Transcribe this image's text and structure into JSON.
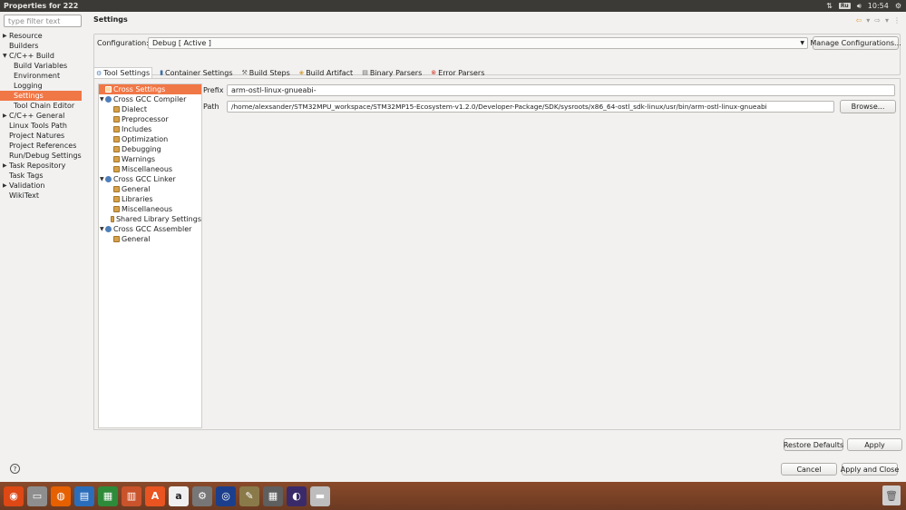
{
  "window": {
    "title": "Properties for 222",
    "keyboard_layout": "Ru",
    "clock": "10:54"
  },
  "left_panel": {
    "filter_placeholder": "type filter text",
    "items": [
      {
        "label": "Resource",
        "expandable": true,
        "indent": 1
      },
      {
        "label": "Builders",
        "expandable": false,
        "indent": 1
      },
      {
        "label": "C/C++ Build",
        "expandable": true,
        "expanded": true,
        "indent": 1
      },
      {
        "label": "Build Variables",
        "expandable": false,
        "indent": 2
      },
      {
        "label": "Environment",
        "expandable": false,
        "indent": 2
      },
      {
        "label": "Logging",
        "expandable": false,
        "indent": 2
      },
      {
        "label": "Settings",
        "expandable": false,
        "indent": 2,
        "selected": true
      },
      {
        "label": "Tool Chain Editor",
        "expandable": false,
        "indent": 2
      },
      {
        "label": "C/C++ General",
        "expandable": true,
        "indent": 1
      },
      {
        "label": "Linux Tools Path",
        "expandable": false,
        "indent": 1
      },
      {
        "label": "Project Natures",
        "expandable": false,
        "indent": 1
      },
      {
        "label": "Project References",
        "expandable": false,
        "indent": 1
      },
      {
        "label": "Run/Debug Settings",
        "expandable": false,
        "indent": 1
      },
      {
        "label": "Task Repository",
        "expandable": true,
        "indent": 1
      },
      {
        "label": "Task Tags",
        "expandable": false,
        "indent": 1
      },
      {
        "label": "Validation",
        "expandable": true,
        "indent": 1
      },
      {
        "label": "WikiText",
        "expandable": false,
        "indent": 1
      }
    ]
  },
  "main": {
    "title": "Settings",
    "configuration_label": "Configuration:",
    "configuration_value": "Debug  [ Active ]",
    "manage_button": "Manage Configurations...",
    "tabs": [
      {
        "label": "Tool Settings",
        "icon": "tool-settings-icon",
        "active": true
      },
      {
        "label": "Container Settings",
        "icon": "container-icon"
      },
      {
        "label": "Build Steps",
        "icon": "build-steps-icon"
      },
      {
        "label": "Build Artifact",
        "icon": "build-artifact-icon"
      },
      {
        "label": "Binary Parsers",
        "icon": "binary-parsers-icon"
      },
      {
        "label": "Error Parsers",
        "icon": "error-parsers-icon"
      }
    ],
    "tool_tree": [
      {
        "label": "Cross Settings",
        "level": 0,
        "type": "tool",
        "selected": true
      },
      {
        "label": "Cross GCC Compiler",
        "level": 0,
        "type": "compiler",
        "expanded": true
      },
      {
        "label": "Dialect",
        "level": 1,
        "type": "tool"
      },
      {
        "label": "Preprocessor",
        "level": 1,
        "type": "tool"
      },
      {
        "label": "Includes",
        "level": 1,
        "type": "tool"
      },
      {
        "label": "Optimization",
        "level": 1,
        "type": "tool"
      },
      {
        "label": "Debugging",
        "level": 1,
        "type": "tool"
      },
      {
        "label": "Warnings",
        "level": 1,
        "type": "tool"
      },
      {
        "label": "Miscellaneous",
        "level": 1,
        "type": "tool"
      },
      {
        "label": "Cross GCC Linker",
        "level": 0,
        "type": "compiler",
        "expanded": true
      },
      {
        "label": "General",
        "level": 1,
        "type": "tool"
      },
      {
        "label": "Libraries",
        "level": 1,
        "type": "tool"
      },
      {
        "label": "Miscellaneous",
        "level": 1,
        "type": "tool"
      },
      {
        "label": "Shared Library Settings",
        "level": 1,
        "type": "tool"
      },
      {
        "label": "Cross GCC Assembler",
        "level": 0,
        "type": "compiler",
        "expanded": true
      },
      {
        "label": "General",
        "level": 1,
        "type": "tool"
      }
    ],
    "prefix_label": "Prefix",
    "prefix_value": "arm-ostl-linux-gnueabi-",
    "path_label": "Path",
    "path_value": "/home/alexsander/STM32MPU_workspace/STM32MP15-Ecosystem-v1.2.0/Developer-Package/SDK/sysroots/x86_64-ostl_sdk-linux/usr/bin/arm-ostl-linux-gnueabi",
    "browse_button": "Browse...",
    "restore_defaults_button": "Restore Defaults",
    "apply_button": "Apply"
  },
  "footer": {
    "cancel_button": "Cancel",
    "apply_close_button": "Apply and Close"
  },
  "taskbar": {
    "apps": [
      {
        "icon": "ubuntu-icon",
        "color": "#dd4814"
      },
      {
        "icon": "files-icon",
        "color": "#8e8e8e"
      },
      {
        "icon": "firefox-icon",
        "color": "#e66000"
      },
      {
        "icon": "writer-icon",
        "color": "#2a6ebb"
      },
      {
        "icon": "calc-icon",
        "color": "#2e8b3a"
      },
      {
        "icon": "impress-icon",
        "color": "#c9532b"
      },
      {
        "icon": "software-center-icon",
        "color": "#e95420"
      },
      {
        "icon": "amazon-icon",
        "color": "#f0f0f0"
      },
      {
        "icon": "settings-icon",
        "color": "#777777"
      },
      {
        "icon": "stm32-icon",
        "color": "#1b3f8c"
      },
      {
        "icon": "gimp-icon",
        "color": "#8a7a4a"
      },
      {
        "icon": "calculator-icon",
        "color": "#5f5f5f"
      },
      {
        "icon": "eclipse-icon",
        "color": "#3b2a6a"
      },
      {
        "icon": "drive-icon",
        "color": "#bdbdbd"
      }
    ]
  }
}
